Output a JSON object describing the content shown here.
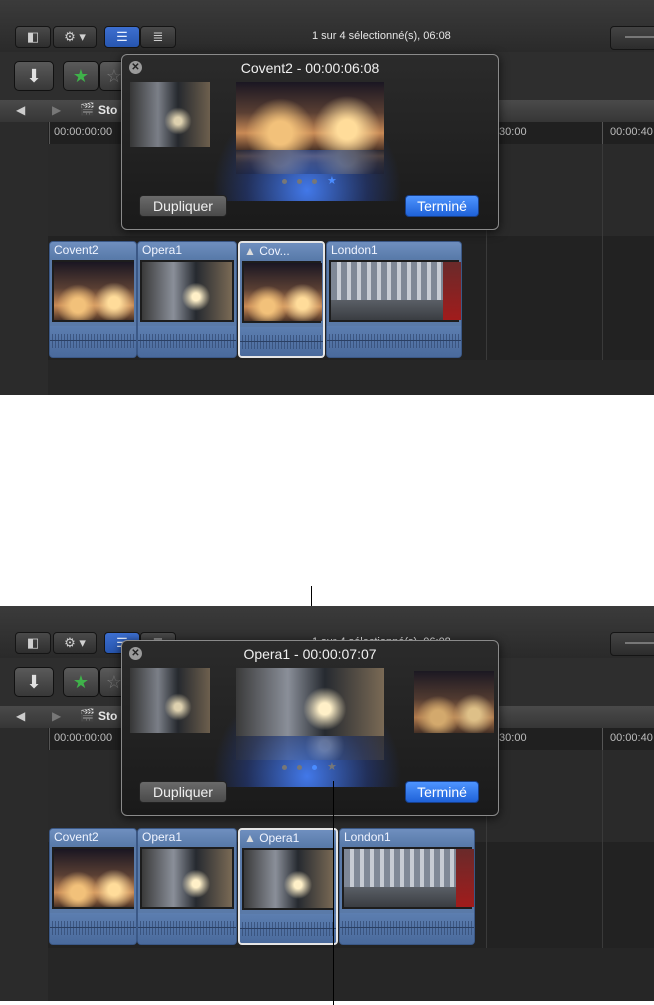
{
  "colors": {
    "panel_bg": "#262626",
    "accent_blue": "#2e6fdf",
    "clip_blue": "#5a7aa8",
    "dot_active": "#4a8cff"
  },
  "panels": [
    {
      "toolbar": {
        "status_text": "1 sur 4  sélectionné(s), 06:08"
      },
      "navbar": {
        "project_name": "Sto"
      },
      "ruler": {
        "timecodes": [
          "00:00:00:00",
          "00:00:30:00",
          "00:00:40"
        ],
        "timecode_labels": [
          "00:00:00:00",
          ":30:00",
          "00:00:40"
        ]
      },
      "popover": {
        "title": "Covent2 - 00:00:06:08",
        "duplicate_label": "Dupliquer",
        "done_label": "Terminé",
        "page_indicator": {
          "count": 4,
          "active_index": 3,
          "last_is_star": true
        }
      },
      "clips": [
        {
          "name": "Covent2",
          "selected": false
        },
        {
          "name": "Opera1",
          "selected": false
        },
        {
          "name": "Cov...",
          "selected": true
        },
        {
          "name": "London1",
          "selected": false
        }
      ]
    },
    {
      "toolbar": {
        "status_text": "1 sur 4  sélectionné(s), 06:08"
      },
      "navbar": {
        "project_name": "Sto"
      },
      "ruler": {
        "timecodes": [
          "00:00:00:00",
          "00:00:30:00",
          "00:00:40"
        ],
        "timecode_labels": [
          "00:00:00:00",
          ":30:00",
          "00:00:40"
        ]
      },
      "popover": {
        "title": "Opera1 - 00:00:07:07",
        "duplicate_label": "Dupliquer",
        "done_label": "Terminé",
        "page_indicator": {
          "count": 4,
          "active_index": 2,
          "last_is_star": true
        }
      },
      "clips": [
        {
          "name": "Covent2",
          "selected": false
        },
        {
          "name": "Opera1",
          "selected": false
        },
        {
          "name": "Opera1",
          "selected": true
        },
        {
          "name": "London1",
          "selected": false
        }
      ]
    }
  ]
}
